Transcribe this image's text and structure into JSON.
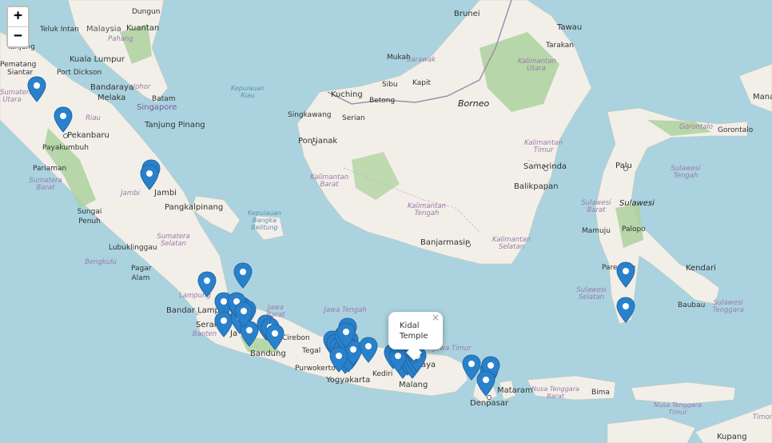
{
  "map": {
    "zoom_in_label": "+",
    "zoom_out_label": "−",
    "popup": {
      "text": "Kidal Temple",
      "close_label": "×"
    },
    "colors": {
      "water": "#aad3df",
      "land": "#f2efe9",
      "forest": "#add19e",
      "border": "#9e8ea8",
      "marker": "#2a81cb"
    },
    "labels": {
      "brunei": "Brunei",
      "tawau": "Tawau",
      "tarakan": "Tarakan",
      "mukah": "Mukah",
      "sarawak": "Sarawak",
      "kalimantan_utara": "Kalimantan Utara",
      "sibu": "Sibu",
      "kapit": "Kapit",
      "kuching": "Kuching",
      "betong": "Betong",
      "borneo": "Borneo",
      "singkawang": "Singkawang",
      "serian": "Serian",
      "pontianak": "Pontianak",
      "kalimantan_timur": "Kalimantan Timur",
      "samarinda": "Samarinda",
      "balikpapan": "Balikpapan",
      "kalimantan_barat": "Kalimantan Barat",
      "kalimantan_tengah": "Kalimantan Tengah",
      "banjarmasin": "Banjarmasin",
      "kalimantan_selatan": "Kalimantan Selatan",
      "gorontalo_prov": "Gorontalo",
      "gorontalo": "Gorontalo",
      "palu": "Palu",
      "sulawesi_tengah": "Sulawesi Tengah",
      "sulawesi_barat": "Sulawesi Barat",
      "sulawesi": "Sulawesi",
      "mamuju": "Mamuju",
      "palopo": "Palopo",
      "pare_pare": "Pare-Pare",
      "kendari": "Kendari",
      "sulawesi_selatan": "Sulawesi Selatan",
      "baubau": "Baubau",
      "sulawesi_tenggara": "Sulawesi Tenggara",
      "manado_edge": "Mana",
      "dungun": "Dungun",
      "teluk_intan": "Teluk Intan",
      "malaysia": "Malaysia",
      "pahang": "Pahang",
      "kuantan": "Kuantan",
      "tanjung": "Tanjung",
      "pematang": "Pematang",
      "siantar": "Siantar",
      "kuala_lumpur": "Kuala Lumpur",
      "port_dickson": "Port Dickson",
      "bandaraya": "Bandaraya",
      "melaka": "Melaka",
      "johor": "Johor",
      "sumatera_utara": "Sumatera Utara",
      "singapore": "Singapore",
      "batam": "Batam",
      "riau": "Riau",
      "kepulauan_riau": "Kepulauan Riau",
      "tanjung_pinang": "Tanjung Pinang",
      "pekanbaru": "Pekanbaru",
      "payakumbuh": "Payakumbuh",
      "pariaman": "Pariaman",
      "sumatera_barat": "Sumatera Barat",
      "jambi": "Jambi",
      "jambi_prov": "Jambi",
      "pangkalpinang": "Pangkalpinang",
      "kep_bangka": "Kepulauan Bangka Belitung",
      "sungai_penuh": "Sungai Penuh",
      "sumatera_selatan": "Sumatera Selatan",
      "lubuklinggau": "Lubuklinggau",
      "bengkulu": "Bengkulu",
      "pagar_alam": "Pagar Alam",
      "lampung": "Lampung",
      "bandar_lampung": "Bandar Lampung",
      "jawa_barat": "Jawa Barat",
      "serang": "Seran",
      "jakarta": "Ja",
      "banten": "Banten",
      "cirebon": "Cirebon",
      "bandung": "Bandung",
      "tegal": "Tegal",
      "jawa_tengah": "Jawa Tengah",
      "purwokerto": "Purwokerto",
      "yogyakarta": "Yogyakarta",
      "kediri": "Kediri",
      "jawa_timur": "Jawa Timur",
      "surabaya": "aya",
      "malang": "Malang",
      "mataram": "Mataram",
      "bima": "Bima",
      "nusa_tenggara_barat": "Nusa Tenggara Barat",
      "nusa_tenggara_timur": "Nusa Tenggara Timur",
      "denpasar": "Denpasar",
      "kupang": "Kupang",
      "timor": "Timor"
    },
    "marker_count": 48
  }
}
